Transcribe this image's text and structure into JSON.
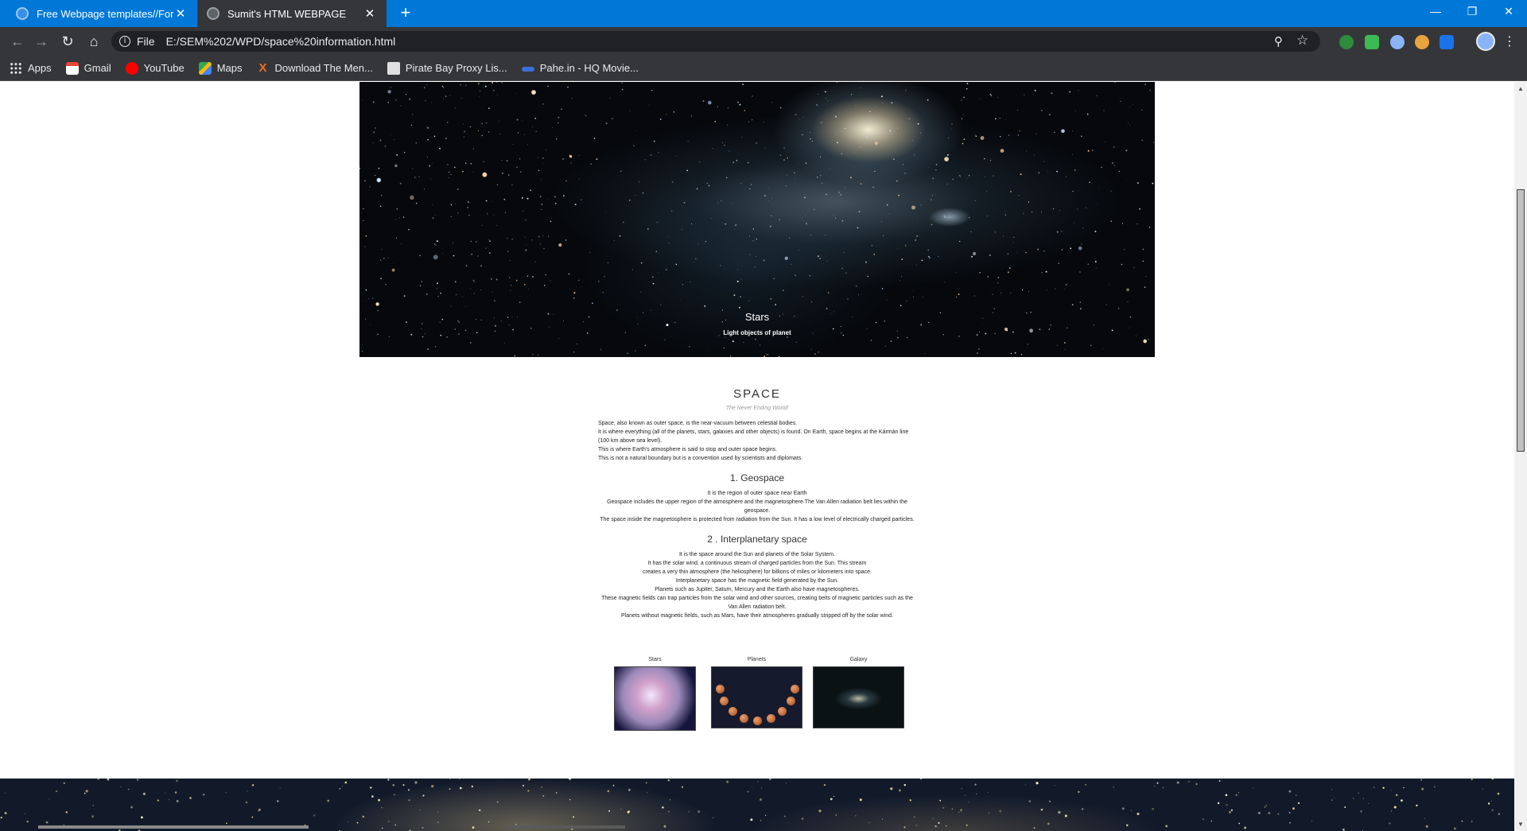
{
  "browser": {
    "tabs": [
      {
        "title": "Free Webpage templates//For ec",
        "active": false
      },
      {
        "title": "Sumit's HTML WEBPAGE",
        "active": true
      }
    ],
    "new_tab": "+",
    "close": "✕",
    "window_controls": {
      "minimize": "—",
      "restore": "❐",
      "close": "✕"
    },
    "address": {
      "scheme_label": "File",
      "url": "E:/SEM%202/WPD/space%20information.html"
    },
    "bookmarks": [
      {
        "label": "Apps",
        "icon": "apps-grid-icon",
        "color": "#e8eaed"
      },
      {
        "label": "Gmail",
        "icon": "gmail-icon",
        "color": "#ea4335"
      },
      {
        "label": "YouTube",
        "icon": "youtube-icon",
        "color": "#ff0000"
      },
      {
        "label": "Maps",
        "icon": "maps-icon",
        "color": "#34a853"
      },
      {
        "label": "Download The Men...",
        "icon": "x-logo-icon",
        "color": "#f06b2a"
      },
      {
        "label": "Pirate Bay Proxy Lis...",
        "icon": "pirate-ship-icon",
        "color": "#d0d0d0"
      },
      {
        "label": "Pahe.in - HQ Movie...",
        "icon": "pahe-icon",
        "color": "#3a6fd8"
      }
    ]
  },
  "page": {
    "hero": {
      "title": "Stars",
      "subtitle": "Light objects of planet"
    },
    "heading": "SPACE",
    "tagline": "The Never Ending World!",
    "intro": [
      "Space, also known as outer space, is the near-vacuum between celestial bodies.",
      "It is where everything (all of the planets, stars, galaxies and other objects) is found. On Earth, space begins at the Kármán line (100 km above sea level).",
      "This is where Earth's atmosphere is said to stop and outer space begins.",
      "This is not a natural boundary but is a convention used by scientists and diplomats."
    ],
    "sections": [
      {
        "title": "1. Geospace",
        "lines": [
          "It is the region of outer space near Earth",
          "Geospace includes the upper region of the atmosphere and the magnetosphere.The Van Allen radiation belt lies within the geospace.",
          "The space inside the magnetosphere is protected from radiation from the Sun. It has a low level of electrically charged particles."
        ]
      },
      {
        "title": "2 . Interplanetary space",
        "lines": [
          "It is the space around the Sun and planets of the Solar System.",
          "It has the solar wind, a continuous stream of charged particles from the Sun. This stream",
          "creates a very thin atmosphere (the heliosphere) for billions of miles or kilometers into space.",
          "Interplanetary space has the magnetic field generated by the Sun.",
          "Planets such as Jupiter, Saturn, Mercury and the Earth also have magnetospheres.",
          "These magnetic fields can trap particles from the solar wind and other sources, creating belts of magnetic particles such as the Van Allen radiation belt.",
          "Planets without magnetic fields, such as Mars, have their atmospheres gradually stripped off by the solar wind."
        ]
      }
    ],
    "gallery": [
      {
        "caption": "Stars"
      },
      {
        "caption": "Planets"
      },
      {
        "caption": "Galaxy"
      }
    ]
  }
}
